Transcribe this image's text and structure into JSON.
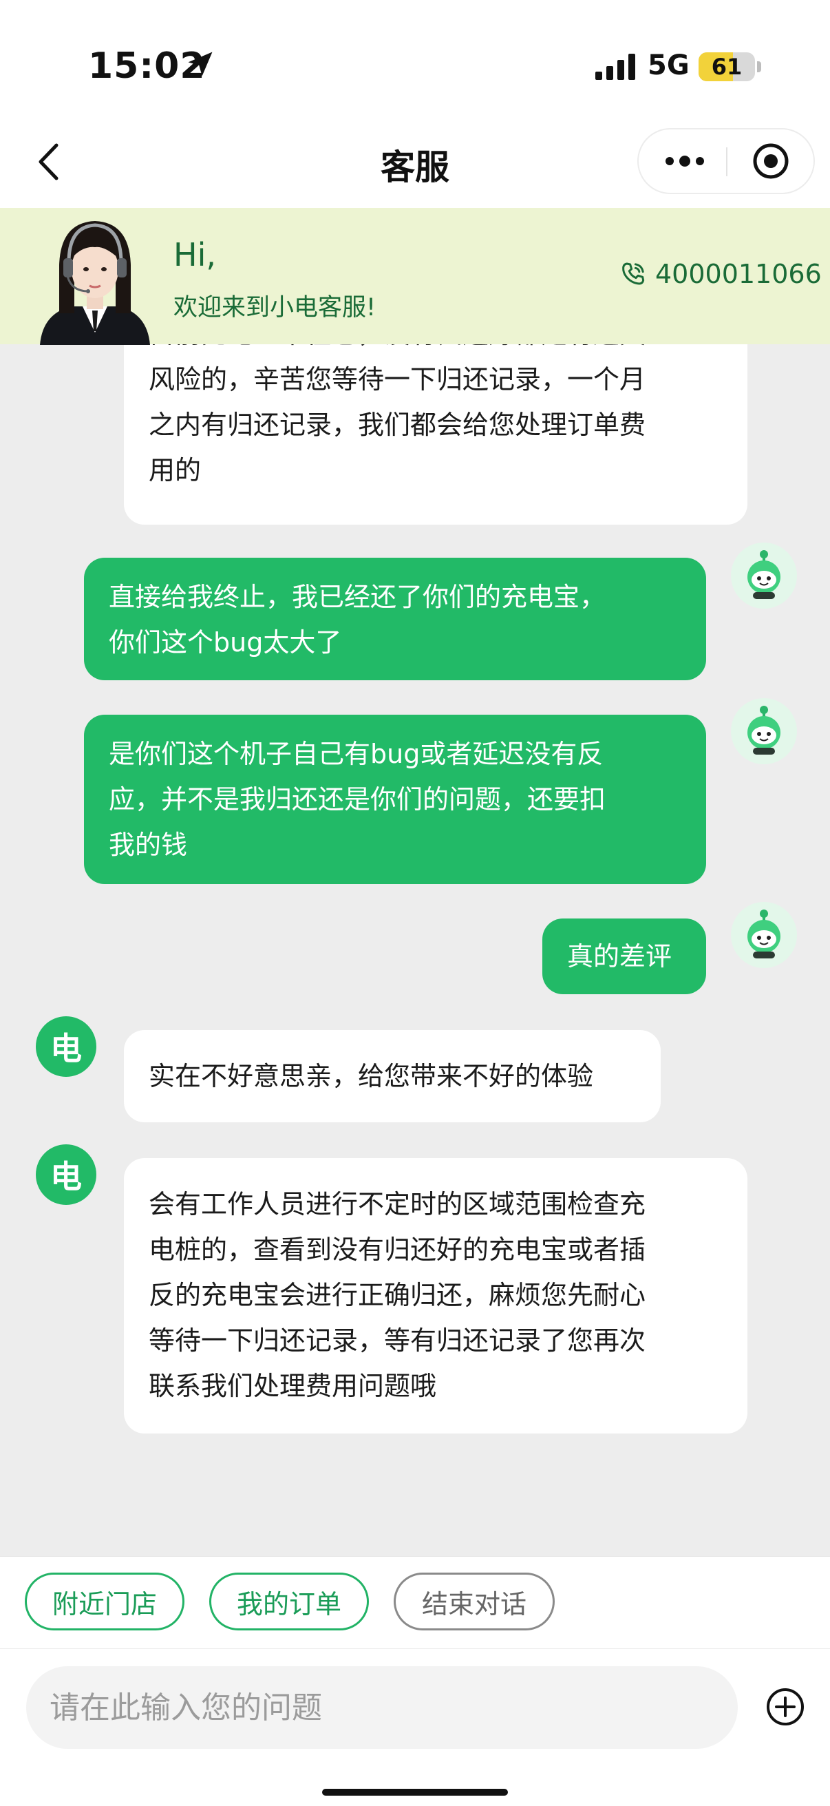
{
  "status_bar": {
    "time": "15:02",
    "network": "5G",
    "battery": "61",
    "battery_level": 0.61
  },
  "nav": {
    "title": "客服"
  },
  "banner": {
    "greeting": "Hi,",
    "welcome": "欢迎来到小电客服!",
    "phone": "4000011066"
  },
  "messages": [
    {
      "from": "bot",
      "lines": [
        "目前充电宝不在仓，没有归还好都是有遗失",
        "风险的，辛苦您等待一下归还记录，一个月",
        "之内有归还记录，我们都会给您处理订单费",
        "用的"
      ]
    },
    {
      "from": "user",
      "lines": [
        "直接给我终止，我已经还了你们的充电宝，",
        "你们这个bug太大了"
      ]
    },
    {
      "from": "user",
      "lines": [
        "是你们这个机子自己有bug或者延迟没有反",
        "应，并不是我归还还是你们的问题，还要扣",
        "我的钱"
      ]
    },
    {
      "from": "user",
      "lines": [
        "真的差评"
      ]
    },
    {
      "from": "bot",
      "lines": [
        "实在不好意思亲，给您带来不好的体验"
      ]
    },
    {
      "from": "bot",
      "lines": [
        "会有工作人员进行不定时的区域范围检查充",
        "电桩的，查看到没有归还好的充电宝或者插",
        "反的充电宝会进行正确归还，麻烦您先耐心",
        "等待一下归还记录，等有归还记录了您再次",
        "联系我们处理费用问题哦"
      ]
    }
  ],
  "quick_replies": [
    "附近门店",
    "我的订单",
    "结束对话"
  ],
  "input": {
    "placeholder": "请在此输入您的问题"
  },
  "bot_avatar_glyph": "电",
  "colors": {
    "accent": "#22ba67",
    "banner_bg": "#edf4d2",
    "banner_text": "#1a6b37"
  }
}
